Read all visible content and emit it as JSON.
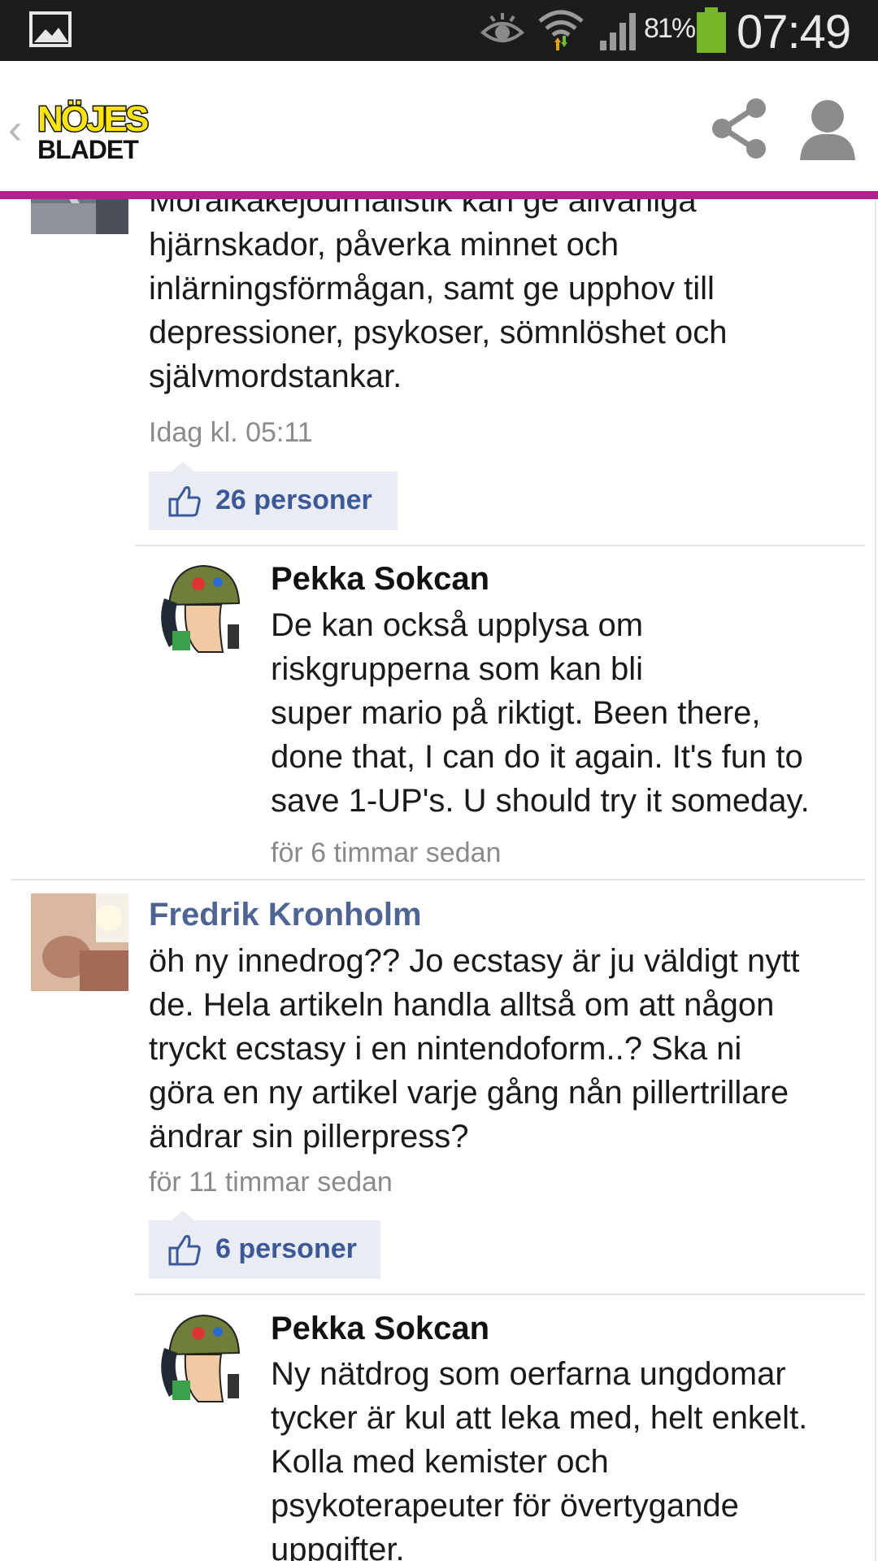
{
  "status_bar": {
    "battery_percent": "81%",
    "time": "07:49",
    "battery_color": "#76b82a"
  },
  "header": {
    "logo_line1": "NÖJES",
    "logo_line2": "BLADET",
    "back_icon": "chevron-left-icon",
    "share_icon": "share-icon",
    "profile_icon": "user-icon",
    "accent_color": "#b41f8f"
  },
  "comments": [
    {
      "body_lines": [
        "Moralkakejournalistik kan ge allvarliga",
        "hjärnskador, påverka minnet och",
        "inlärningsförmågan, samt ge upphov till",
        "depressioner, psykoser, sömnlöshet och",
        "självmordstankar."
      ],
      "timestamp": "Idag kl. 05:11",
      "likes": "26 personer",
      "reply": {
        "author": "Pekka Sokcan",
        "body_lines": [
          "De kan också upplysa om",
          "riskgrupperna som kan bli",
          "super mario på riktigt. Been there,",
          "done that, I can do it again. It's fun to",
          "save 1-UP's. U should try it someday."
        ],
        "timestamp": "för 6 timmar sedan"
      }
    },
    {
      "author": "Fredrik Kronholm",
      "body_lines": [
        "öh ny innedrog?? Jo ecstasy är ju väldigt nytt",
        "de. Hela artikeln handla alltså om att någon",
        "tryckt ecstasy i en nintendoform..? Ska ni",
        "göra en ny artikel varje gång nån pillertrillare",
        "ändrar sin pillerpress?"
      ],
      "timestamp": "för 11 timmar sedan",
      "likes": "6 personer",
      "reply": {
        "author": "Pekka Sokcan",
        "body_lines": [
          "Ny nätdrog som oerfarna ungdomar",
          "tycker är kul att leka med, helt enkelt.",
          "Kolla med kemister och",
          "psykoterapeuter för övertygande",
          "uppgifter."
        ]
      }
    }
  ]
}
